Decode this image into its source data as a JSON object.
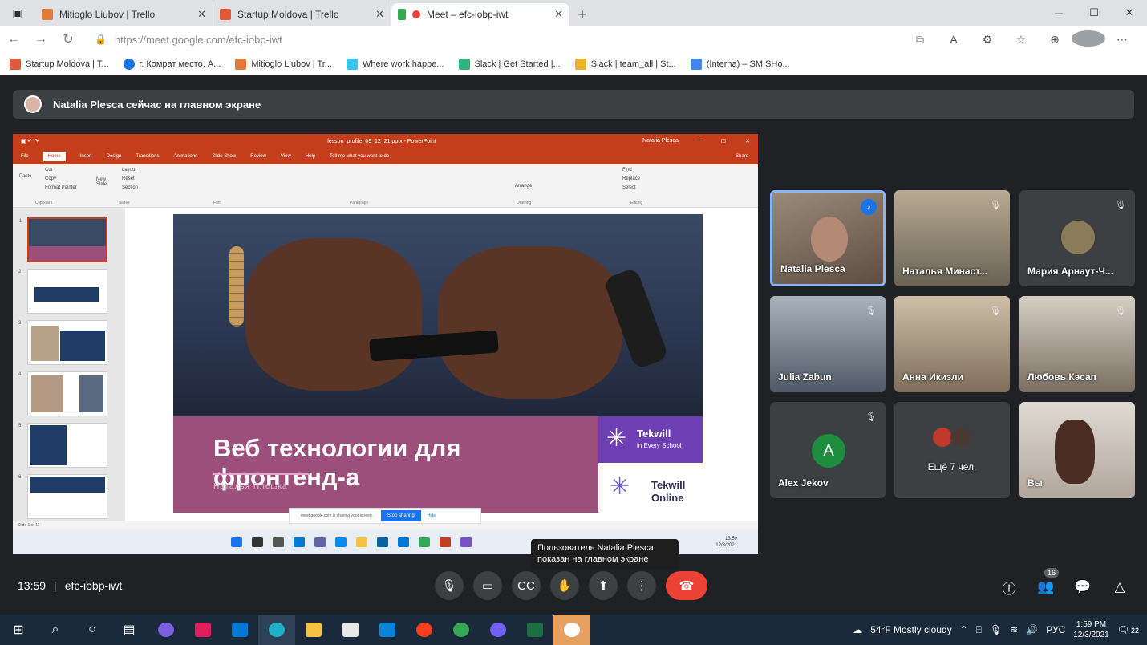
{
  "browser": {
    "tabs": [
      {
        "title": "Mitioglo Liubov | Trello",
        "color": "#e07b39"
      },
      {
        "title": "Startup Moldova | Trello",
        "color": "#e05a39"
      },
      {
        "title": "Meet – efc-iobp-iwt",
        "color": "#ea4335",
        "active": true
      }
    ],
    "url": "https://meet.google.com/efc-iobp-iwt",
    "bookmarks": [
      {
        "label": "Startup Moldova | T...",
        "color": "#e05a39"
      },
      {
        "label": "г. Комрат место, А...",
        "color": "#1a73e8"
      },
      {
        "label": "Mitioglo Liubov | Tr...",
        "color": "#e07b39"
      },
      {
        "label": "Where work happe...",
        "color": "#4a154b"
      },
      {
        "label": "Slack | Get Started |...",
        "color": "#4a154b"
      },
      {
        "label": "Slack | team_all | St...",
        "color": "#4a154b"
      },
      {
        "label": "(Interna) – SM SHo...",
        "color": "#4285f4"
      }
    ]
  },
  "banner": {
    "text": "Natalia Plesca сейчас на главном экране"
  },
  "presentation": {
    "window_title": "lesson_profile_09_12_21.pptx - PowerPoint",
    "user": "Natalia Plesca",
    "menu": [
      "File",
      "Home",
      "Insert",
      "Design",
      "Transitions",
      "Animations",
      "Slide Show",
      "Review",
      "View",
      "Help",
      "Tell me what you want to do",
      "Share"
    ],
    "ribbon": {
      "clipboard": [
        "Cut",
        "Copy",
        "Format Painter"
      ],
      "slides": [
        "Layout",
        "Reset",
        "Section"
      ],
      "editing": [
        "Find",
        "Replace",
        "Select"
      ],
      "groups": [
        "Clipboard",
        "Slides",
        "Font",
        "Paragraph",
        "Drawing",
        "Editing"
      ],
      "paste": "Paste",
      "new_slide": "New Slide",
      "arrange": "Arrange"
    },
    "slide_numbers": [
      "1",
      "2",
      "3",
      "4",
      "5",
      "6"
    ],
    "slide_title": "Веб технологии для фронтенд-а",
    "slide_subtitle": "Наталья Плешка",
    "logo_top": {
      "a": "Tekwill",
      "b": "in Every School"
    },
    "logo_bottom": {
      "a": "Tekwill",
      "b": "Online"
    },
    "statusbar": "Slide 1 of 11",
    "sharing_notice": "meet.google.com is sharing your screen.",
    "stop_sharing": "Stop sharing",
    "hide": "Hide",
    "inner_clock": {
      "time": "13:59",
      "date": "12/3/2021"
    }
  },
  "participants": [
    {
      "name": "Natalia Plesca",
      "mic": "active",
      "bg": "#7a6a5c"
    },
    {
      "name": "Наталья Минаст...",
      "mic": "muted",
      "bg": "#8a8270"
    },
    {
      "name": "Мария Арнаут-Ч...",
      "mic": "muted",
      "bg": "#3c4043"
    },
    {
      "name": "Julia Zabun",
      "mic": "muted",
      "bg": "#6f7a86"
    },
    {
      "name": "Анна Икизли",
      "mic": "muted",
      "bg": "#8a7c6a"
    },
    {
      "name": "Любовь Кэсап",
      "mic": "muted",
      "bg": "#9a8a7a"
    },
    {
      "name": "Alex Jekov",
      "mic": "muted",
      "initial": "A"
    },
    {
      "name": "Ещё 7 чел.",
      "mic": "none"
    },
    {
      "name": "Вы",
      "mic": "none",
      "bg": "#c8bfb6"
    }
  ],
  "tooltip": "Пользователь Natalia Plesca показан на главном экране",
  "meeting": {
    "time": "13:59",
    "code": "efc-iobp-iwt",
    "people_count": "16"
  },
  "taskbar": {
    "weather": "54°F  Mostly cloudy",
    "lang": "РУС",
    "time": "1:59 PM",
    "date": "12/3/2021",
    "notifications": "22"
  }
}
